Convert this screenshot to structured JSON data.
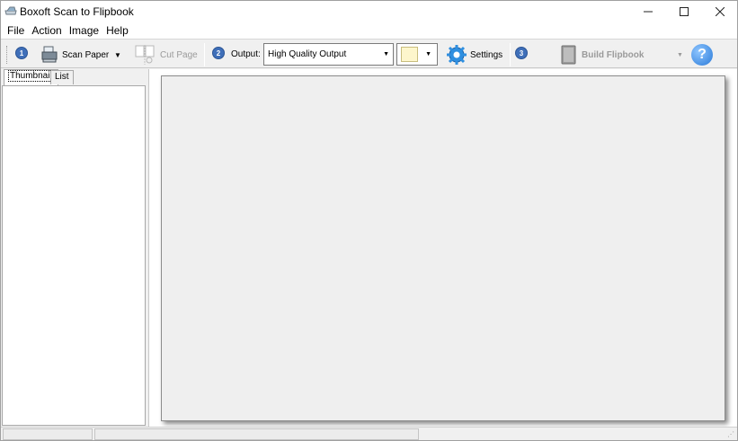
{
  "window": {
    "title": "Boxoft Scan to Flipbook"
  },
  "menu": {
    "items": [
      "File",
      "Action",
      "Image",
      "Help"
    ]
  },
  "toolbar": {
    "step1": "1",
    "scan_label": "Scan Paper",
    "cut_label": "Cut Page",
    "step2": "2",
    "output_label": "Output:",
    "output_value": "High Quality Output",
    "settings_label": "Settings",
    "step3": "3",
    "build_label": "Build Flipbook",
    "help_glyph": "?"
  },
  "tabs": {
    "thumbnail": "Thumbnail",
    "list": "List"
  },
  "colors": {
    "page_swatch": "#fdf6cc",
    "accent": "#3f6fb9"
  },
  "icons": [
    "app-scanner-icon",
    "scanner-icon",
    "cut-page-icon",
    "settings-gear-icon",
    "flipbook-icon",
    "help-icon"
  ]
}
